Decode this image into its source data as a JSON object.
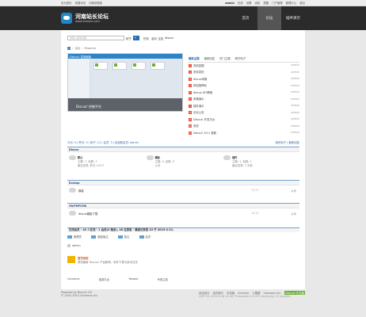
{
  "topbar": {
    "left": [
      "设为首页",
      "收藏本站",
      "切换到宽版"
    ],
    "user": "admin",
    "right": [
      "在线",
      "设置",
      "消息",
      "提醒",
      "门户管理",
      "管理中心",
      "退出"
    ]
  },
  "header": {
    "logo_title": "河南站长论坛",
    "logo_sub": "www.hnsszh.com",
    "nav": [
      "首页",
      "论坛",
      "插件演示"
    ],
    "active_nav": 1
  },
  "search": {
    "placeholder": "请输入搜索内容",
    "type": "帖子",
    "hot_label": "热搜:",
    "hot": [
      "活动",
      "交友",
      "discuz"
    ]
  },
  "breadcrumb": [
    "论坛",
    "Powered"
  ],
  "banner": {
    "bar_title": "Discuz! 控制面板",
    "caption": "Discuz! 控制平台"
  },
  "tabs": [
    "最新主题",
    "最新回复",
    "热门主题",
    "精华帖子"
  ],
  "threads": [
    {
      "title": "测试贴图",
      "user": "admin"
    },
    {
      "title": "测试发帖",
      "user": "admin"
    },
    {
      "title": "discuz风格",
      "user": "admin"
    },
    {
      "title": "网站推荐帖",
      "user": "admin"
    },
    {
      "title": "discuz DIY教程",
      "user": "admin"
    },
    {
      "title": "风格演示",
      "user": "admin"
    },
    {
      "title": "插件演示",
      "user": "admin"
    },
    {
      "title": "论坛公告",
      "user": "admin"
    },
    {
      "title": "Discuz! 开发平台",
      "user": "admin"
    },
    {
      "title": "测试",
      "user": "admin"
    },
    {
      "title": "Discuz! X3.2 更新",
      "user": "admin"
    }
  ],
  "forumbar": {
    "left": "今日: 0 | 昨日: 0 | 帖子: 21 | 会员: 3 | 欢迎新会员: admin",
    "right": "我的帖子 | 最新回复"
  },
  "sections": [
    {
      "title": "Discuz",
      "forums": [
        {
          "name": "默认",
          "meta": "主题: 7, 帖数: 7",
          "last": "最后发表: 昨天 14:27"
        },
        {
          "name": "模板",
          "meta": "主题: 0, 帖数: 0",
          "last": "从未"
        },
        {
          "name": "插件",
          "meta": "主题: 1, 帖数: 1",
          "last": "最后发表: 1 天前"
        }
      ]
    },
    {
      "title": "Ecshop",
      "rows": [
        {
          "name": "模板",
          "counts": "0 / 0",
          "last": "从未"
        }
      ]
    },
    {
      "title": "V8/PHPCMS",
      "rows": [
        {
          "name": "discuz模板下载",
          "counts": "0 / 0",
          "last": "从未"
        }
      ]
    }
  ],
  "online": {
    "text": "在线会员 - 49 人在线 - 1 会员(0 隐身), 48 位游客 - 最高记录是 43 于 2015-4-21.",
    "roles": [
      "管理员",
      "超级版主",
      "版主",
      "会员"
    ],
    "member": "admin"
  },
  "dz": {
    "title": "官方论坛",
    "desc": "提供最新 Discuz! 产品新闻、软件下载与技术交流"
  },
  "links": [
    "Comsenz",
    "漫游平台",
    "Yeswan",
    "专用主机"
  ],
  "footer": {
    "powered": "Powered by Discuz! X3",
    "copy": "© 2001-2013 Comsenz Inc.",
    "right": [
      "站长统计",
      "站内统计",
      "手机版",
      "Archiver",
      "小黑屋",
      "Comsenz Inc."
    ],
    "badge": "Discuz! 中文版",
    "gmt": "GMT+8, 2015-6-18 14:36, Processed in 0.057 second(s), 21 queries."
  }
}
